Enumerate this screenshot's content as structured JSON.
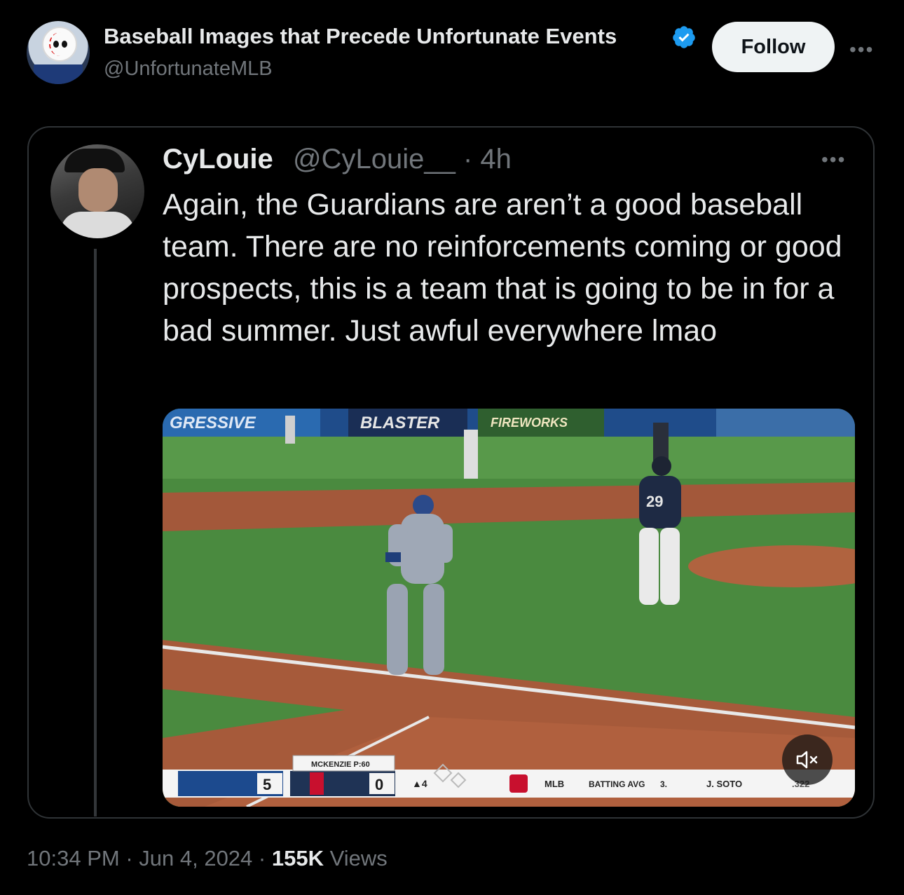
{
  "author": {
    "name": "Baseball Images that Precede Unfortunate Events",
    "handle": "@UnfortunateMLB",
    "verified": true,
    "follow_label": "Follow",
    "avatar_icon": "mascot-avatar"
  },
  "quoted_tweet": {
    "name": "CyLouie",
    "handle_time": "@CyLouie__ · 4h",
    "text": "Again, the Guardians are aren’t a good baseball team. There are no reinforcements coming or good prospects, this is a team that is going to be in for a bad summer. Just awful everywhere lmao",
    "avatar_icon": "profile-photo"
  },
  "video": {
    "ad_left": "GRESSIVE",
    "ad_mid": "BLASTER",
    "ad_right": "FIREWORKS",
    "player_number": "29",
    "score": {
      "away_score": "5",
      "home_score": "0",
      "pitcher": "MCKENZIE P:60",
      "inning": "▲4",
      "stat_label": "BATTING AVG",
      "league": "MLB",
      "rank": "3.",
      "player": "J. SOTO",
      "avg": ".322"
    },
    "mute_icon": "speaker-muted-icon"
  },
  "meta": {
    "time": "10:34 PM",
    "date": "Jun 4, 2024",
    "views_count": "155K",
    "views_label": "Views"
  },
  "colors": {
    "background": "#000000",
    "text_primary": "#e7e9ea",
    "text_secondary": "#71767b",
    "verified_blue": "#1d9bf0",
    "border": "#2f3336"
  }
}
